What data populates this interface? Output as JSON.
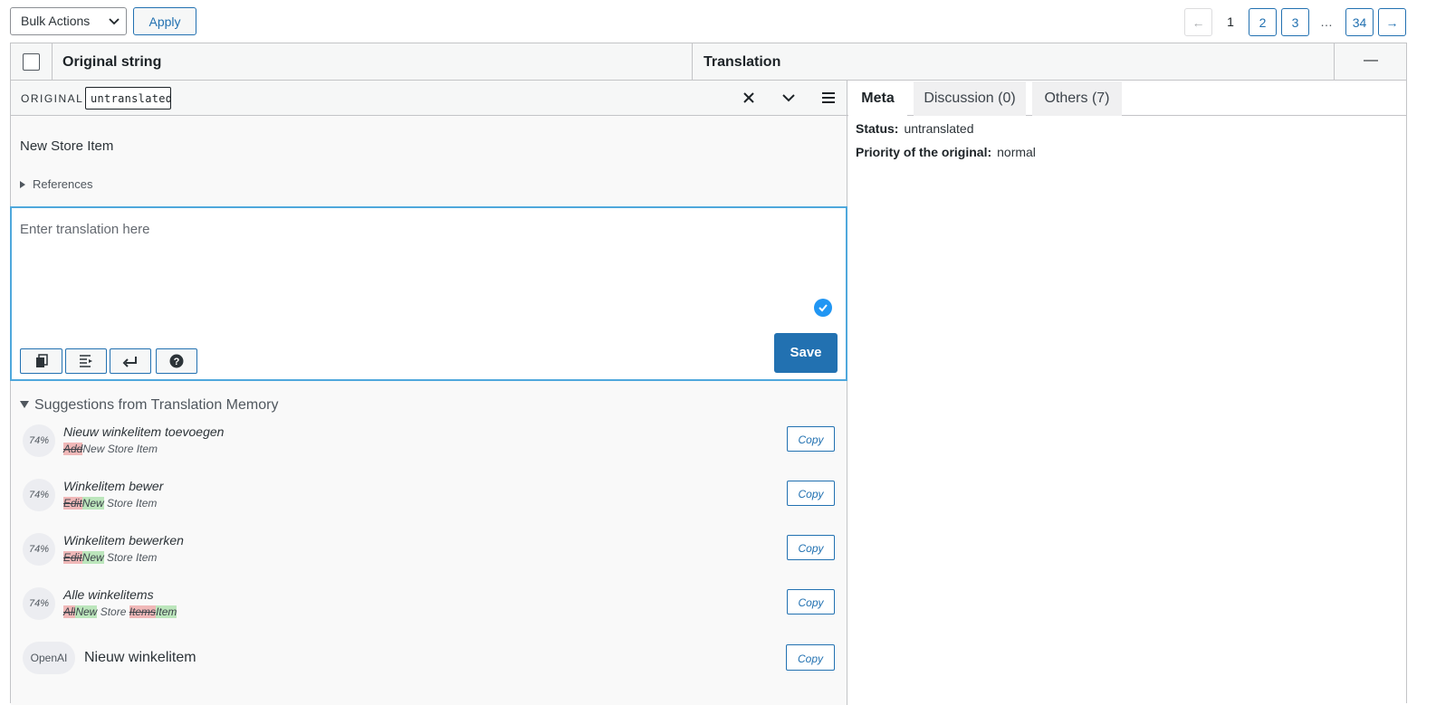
{
  "toolbar": {
    "bulk_actions": "Bulk Actions",
    "apply": "Apply"
  },
  "pagination": {
    "prev": "←",
    "current": "1",
    "pages": [
      "2",
      "3"
    ],
    "ellipsis": "…",
    "last": "34",
    "next": "→"
  },
  "table_header": {
    "original": "Original string",
    "translation": "Translation",
    "collapse": "—"
  },
  "editor": {
    "label": "ORIGINAL",
    "status": "untranslated",
    "original_text": "New Store Item",
    "references": "References",
    "placeholder": "Enter translation here",
    "save": "Save",
    "suggestions_heading": "Suggestions from Translation Memory",
    "suggestions": [
      {
        "score": "74%",
        "text": "Nieuw winkelitem toevoegen",
        "diff": [
          {
            "t": "Add",
            "k": "del"
          },
          {
            "t": "New Store Item",
            "k": "eq"
          }
        ],
        "copy": "Copy"
      },
      {
        "score": "74%",
        "text": "Winkelitem bewer",
        "diff": [
          {
            "t": "Edit",
            "k": "del"
          },
          {
            "t": "New",
            "k": "ins"
          },
          {
            "t": " Store Item",
            "k": "eq"
          }
        ],
        "copy": "Copy"
      },
      {
        "score": "74%",
        "text": "Winkelitem bewerken",
        "diff": [
          {
            "t": "Edit",
            "k": "del"
          },
          {
            "t": "New",
            "k": "ins"
          },
          {
            "t": " Store Item",
            "k": "eq"
          }
        ],
        "copy": "Copy"
      },
      {
        "score": "74%",
        "text": "Alle winkelitems",
        "diff": [
          {
            "t": "All",
            "k": "del"
          },
          {
            "t": "New",
            "k": "ins"
          },
          {
            "t": " Store ",
            "k": "eq"
          },
          {
            "t": "Items",
            "k": "del"
          },
          {
            "t": "Item",
            "k": "ins"
          }
        ],
        "copy": "Copy"
      }
    ],
    "openai": {
      "label": "OpenAI",
      "text": "Nieuw winkelitem",
      "copy": "Copy"
    }
  },
  "meta": {
    "tabs": [
      "Meta",
      "Discussion (0)",
      "Others (7)"
    ],
    "status_label": "Status:",
    "status_value": "untranslated",
    "priority_label": "Priority of the original:",
    "priority_value": "normal"
  },
  "colors": {
    "accent": "#2271b1",
    "focus_border": "#4fa8dc",
    "deleted": "#f0b8b8",
    "inserted": "#bce6bc"
  }
}
